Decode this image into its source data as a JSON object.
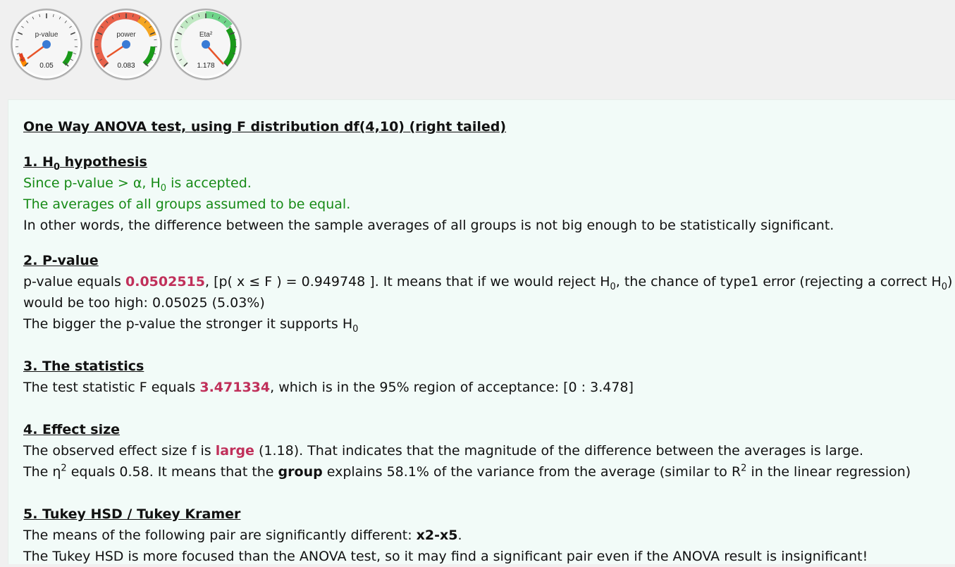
{
  "gauges": [
    {
      "label": "p-value",
      "value_text": "0.05",
      "level": 0.05,
      "colors": {
        "low": "#ff6a00",
        "mid": "#f7f7f7",
        "high": "#1a9a1a"
      }
    },
    {
      "label": "power",
      "value_text": "0.083",
      "level": 0.083,
      "colors": {
        "low": "#e8614a",
        "mid": "#f5a623",
        "high": "#1a9a1a"
      }
    },
    {
      "label": "Eta²",
      "value_text": "1.178",
      "level": 1.178,
      "colors": {
        "low": "#d9f1d9",
        "mid": "#6fd48a",
        "high": "#1a9a1a"
      }
    }
  ],
  "report": {
    "title": "One Way ANOVA test, using F distribution df(4,10) (right tailed)",
    "s1": {
      "heading_pre": "1. H",
      "heading_sub": "0",
      "heading_post": " hypothesis",
      "l1_pre": "Since p-value > α, H",
      "l1_sub": "0",
      "l1_post": " is accepted.",
      "l2": "The averages of all groups assumed to be equal.",
      "l3": "In other words, the difference between the sample averages of all groups is not big enough to be statistically significant."
    },
    "s2": {
      "heading": "2. P-value",
      "pre": "p-value equals ",
      "pval": "0.0502515",
      "mid": ", [p( x ≤ F ) = 0.949748 ]. It means that if we would reject H",
      "sub1": "0",
      "mid2": ", the chance of type1 error (rejecting a correct H",
      "sub2": "0",
      "post": ") would be too high: 0.05025 (5.03%)",
      "l2_pre": "The bigger the p-value the stronger it supports H",
      "l2_sub": "0"
    },
    "s3": {
      "heading": "3. The statistics",
      "pre": "The test statistic F equals ",
      "fval": "3.471334",
      "post": ", which is in the 95% region of acceptance: [0 : 3.478]"
    },
    "s4": {
      "heading": "4. Effect size",
      "l1_pre": "The observed effect size f is ",
      "l1_hl": "large",
      "l1_post": " (1.18). That indicates that the magnitude of the difference between the averages is large.",
      "l2_a": "The η",
      "l2_sup1": "2",
      "l2_b": " equals 0.58. It means that the ",
      "l2_bold": "group",
      "l2_c": " explains 58.1% of the variance from the average (similar to R",
      "l2_sup2": "2",
      "l2_d": " in the linear regression)"
    },
    "s5": {
      "heading": "5. Tukey HSD / Tukey Kramer",
      "l1_pre": "The means of the following pair are significantly different: ",
      "l1_bold": "x2-x5",
      "l1_post": ".",
      "l2": "The Tukey HSD is more focused than the ANOVA test, so it may find a significant pair even if the ANOVA result is insignificant!"
    }
  }
}
